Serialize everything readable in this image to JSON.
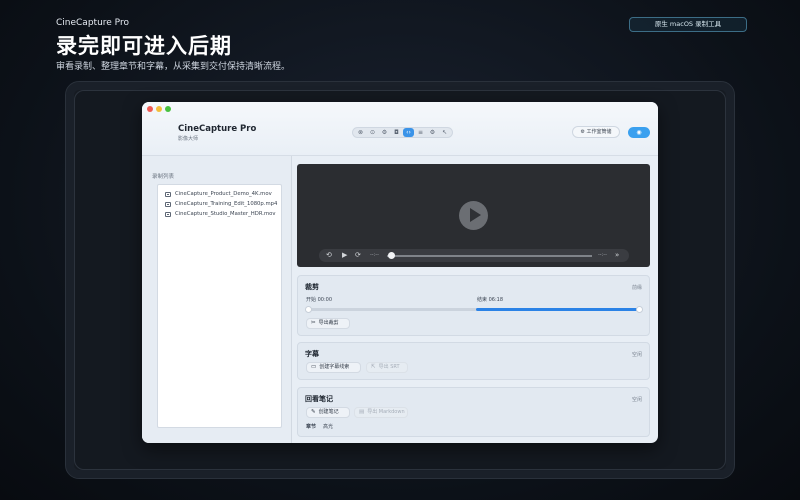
{
  "hero": {
    "app_name": "CineCapture Pro",
    "headline": "录完即可进入后期",
    "subline": "审看录制、整理章节和字幕，从采集到交付保持清晰流程。",
    "badge": "原生 macOS 录制工具"
  },
  "window": {
    "title": "CineCapture Pro",
    "subtitle": "影像大师",
    "workspace_button": "工作室筒储",
    "toolbar_icons": [
      "close-icon",
      "settings-icon",
      "gear-icon",
      "lock-icon",
      "code-icon",
      "list-icon",
      "gear-icon",
      "cursor-icon"
    ],
    "active_tool_index": 4
  },
  "sidebar": {
    "title": "录制列表",
    "files": [
      "CineCapture_Product_Demo_4K.mov",
      "CineCapture_Training_Edit_1080p.mp4",
      "CineCapture_Studio_Master_HDR.mov"
    ]
  },
  "player": {
    "current_time": "--:--",
    "duration": "--:--",
    "progress": 0
  },
  "trim": {
    "title": "裁剪",
    "action": "前缘",
    "start_label": "开始 00:00",
    "end_label": "结束 06:18",
    "export_button": "导出裁剪"
  },
  "subtitles": {
    "title": "字幕",
    "action": "空闲",
    "create_button": "创建字幕线索",
    "export_button": "导出 SRT"
  },
  "notes": {
    "title": "回看笔记",
    "action": "空闲",
    "create_button": "创建笔记",
    "export_button": "导出 Markdown",
    "col_chapter": "章节",
    "col_highlight": "高光"
  },
  "colors": {
    "accent": "#2b82e6",
    "primary_button": "#3aa0ef",
    "background": "#0c1118"
  }
}
